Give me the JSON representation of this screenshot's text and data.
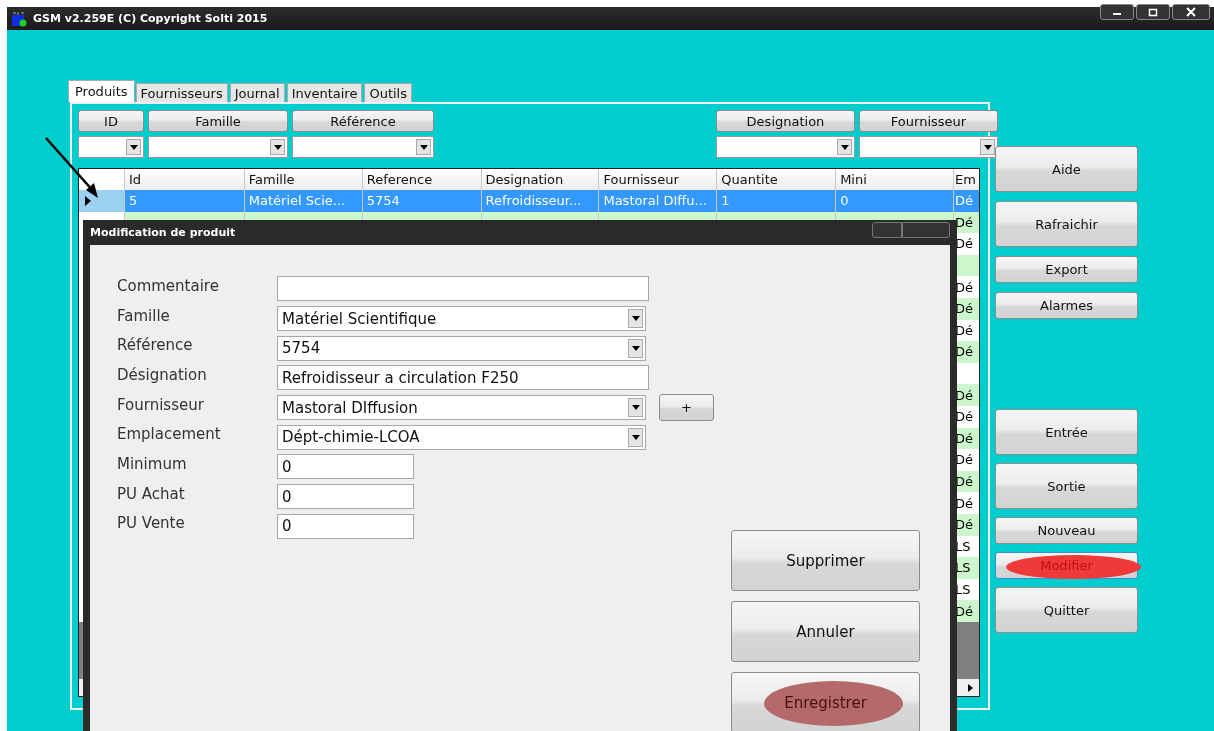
{
  "window": {
    "title": "GSM v2.259E (C) Copyright Solti 2015"
  },
  "tabs": [
    {
      "label": "Produits",
      "selected": true
    },
    {
      "label": "Fournisseurs",
      "selected": false
    },
    {
      "label": "Journal",
      "selected": false
    },
    {
      "label": "Inventaire",
      "selected": false
    },
    {
      "label": "Outils",
      "selected": false
    }
  ],
  "filters": {
    "left": [
      "ID",
      "Famille",
      "Référence"
    ],
    "right": [
      "Designation",
      "Fournisseur"
    ]
  },
  "table": {
    "columns": [
      "Id",
      "Famille",
      "Reference",
      "Designation",
      "Fournisseur",
      "Quantite",
      "Mini",
      "Em"
    ],
    "rows": [
      {
        "selected": true,
        "cells": [
          "5",
          "Matériel Scie...",
          "5754",
          "Refroidisseur...",
          "Mastoral DIffu...",
          "1",
          "0",
          "Dé"
        ]
      },
      {
        "selected": false,
        "emplacement": "Dé"
      },
      {
        "selected": false,
        "emplacement": "Dé"
      },
      {
        "selected": false
      },
      {
        "selected": false,
        "emplacement": "Dé"
      },
      {
        "selected": false,
        "emplacement": "Dé"
      },
      {
        "selected": false,
        "emplacement": "Dé"
      },
      {
        "selected": false,
        "emplacement": "Dé"
      },
      {
        "selected": false
      },
      {
        "selected": false,
        "emplacement": "Dé"
      },
      {
        "selected": false,
        "emplacement": "Dé"
      },
      {
        "selected": false,
        "emplacement": "Dé"
      },
      {
        "selected": false,
        "emplacement": "Dé"
      },
      {
        "selected": false,
        "emplacement": "Dé"
      },
      {
        "selected": false,
        "emplacement": "Dé"
      },
      {
        "selected": false,
        "emplacement": "Dé"
      },
      {
        "selected": false,
        "emplacement": "LS"
      },
      {
        "selected": false,
        "emplacement": "LS"
      },
      {
        "selected": false,
        "emplacement": "LS"
      },
      {
        "selected": false,
        "emplacement": "Dé"
      }
    ]
  },
  "side_buttons_top": [
    {
      "label": "Aide",
      "kind": "large"
    },
    {
      "label": "Rafraichir",
      "kind": "large"
    },
    {
      "label": "Export",
      "kind": "small"
    },
    {
      "label": "Alarmes",
      "kind": "small"
    }
  ],
  "side_buttons_bottom": [
    {
      "label": "Entrée",
      "kind": "large"
    },
    {
      "label": "Sortie",
      "kind": "large"
    },
    {
      "label": "Nouveau",
      "kind": "small"
    },
    {
      "label": "Modifier",
      "kind": "small",
      "focused": true,
      "color": "#f03a3a"
    },
    {
      "label": "Quitter",
      "kind": "large"
    }
  ],
  "dialog": {
    "title": "Modification de produit",
    "fields": [
      {
        "label": "Commentaire",
        "kind": "text"
      },
      {
        "label": "Famille",
        "kind": "combo",
        "value": "Matériel Scientifique"
      },
      {
        "label": "Référence",
        "kind": "combo",
        "value": "5754"
      },
      {
        "label": "Désignation",
        "kind": "text",
        "value": "Refroidisseur a circulation F250"
      },
      {
        "label": "Fournisseur",
        "kind": "combo",
        "value": "Mastoral DIffusion",
        "extra_button": "+"
      },
      {
        "label": "Emplacement",
        "kind": "combo",
        "value": "Dépt-chimie-LCOA"
      },
      {
        "label": "Minimum",
        "kind": "number",
        "value": "0"
      },
      {
        "label": "PU Achat",
        "kind": "number",
        "value": "0"
      },
      {
        "label": "PU Vente",
        "kind": "number",
        "value": "0"
      }
    ],
    "buttons": [
      {
        "label": "Supprimer"
      },
      {
        "label": "Annuler"
      },
      {
        "label": "Enregistrer",
        "color": "#b46a6a"
      }
    ]
  }
}
